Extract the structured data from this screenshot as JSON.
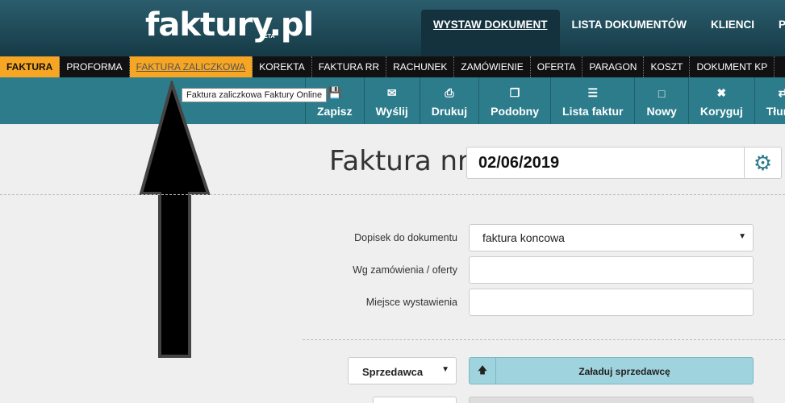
{
  "header": {
    "logo": "faktury.pl",
    "logo_badge": "BETA",
    "nav": [
      "WYSTAW DOKUMENT",
      "LISTA DOKUMENTÓW",
      "KLIENCI",
      "PR"
    ]
  },
  "doc_types": [
    "FAKTURA",
    "PROFORMA",
    "FAKTURA ZALICZKOWA",
    "KOREKTA",
    "FAKTURA RR",
    "RACHUNEK",
    "ZAMÓWIENIE",
    "OFERTA",
    "PARAGON",
    "KOSZT",
    "DOKUMENT KP"
  ],
  "toolbar": {
    "save": "Zapisz",
    "send": "Wyślij",
    "print": "Drukuj",
    "similar": "Podobny",
    "list": "Lista faktur",
    "new": "Nowy",
    "correct": "Koryguj",
    "translate": "Tłuma"
  },
  "tooltip": "Faktura zaliczkowa Faktury Online",
  "invoice": {
    "label": "Faktura nr",
    "number": "02/06/2019"
  },
  "form": {
    "note_label": "Dopisek do dokumentu",
    "note_value": "faktura koncowa",
    "order_label": "Wg zamówienia / oferty",
    "order_value": "",
    "place_label": "Miejsce wystawienia",
    "place_value": ""
  },
  "seller": {
    "select_value": "Sprzedawca",
    "load_label": "Załaduj sprzedawcę"
  },
  "icons": {
    "accent": "#2c7c8c",
    "highlight": "#f6a623"
  }
}
